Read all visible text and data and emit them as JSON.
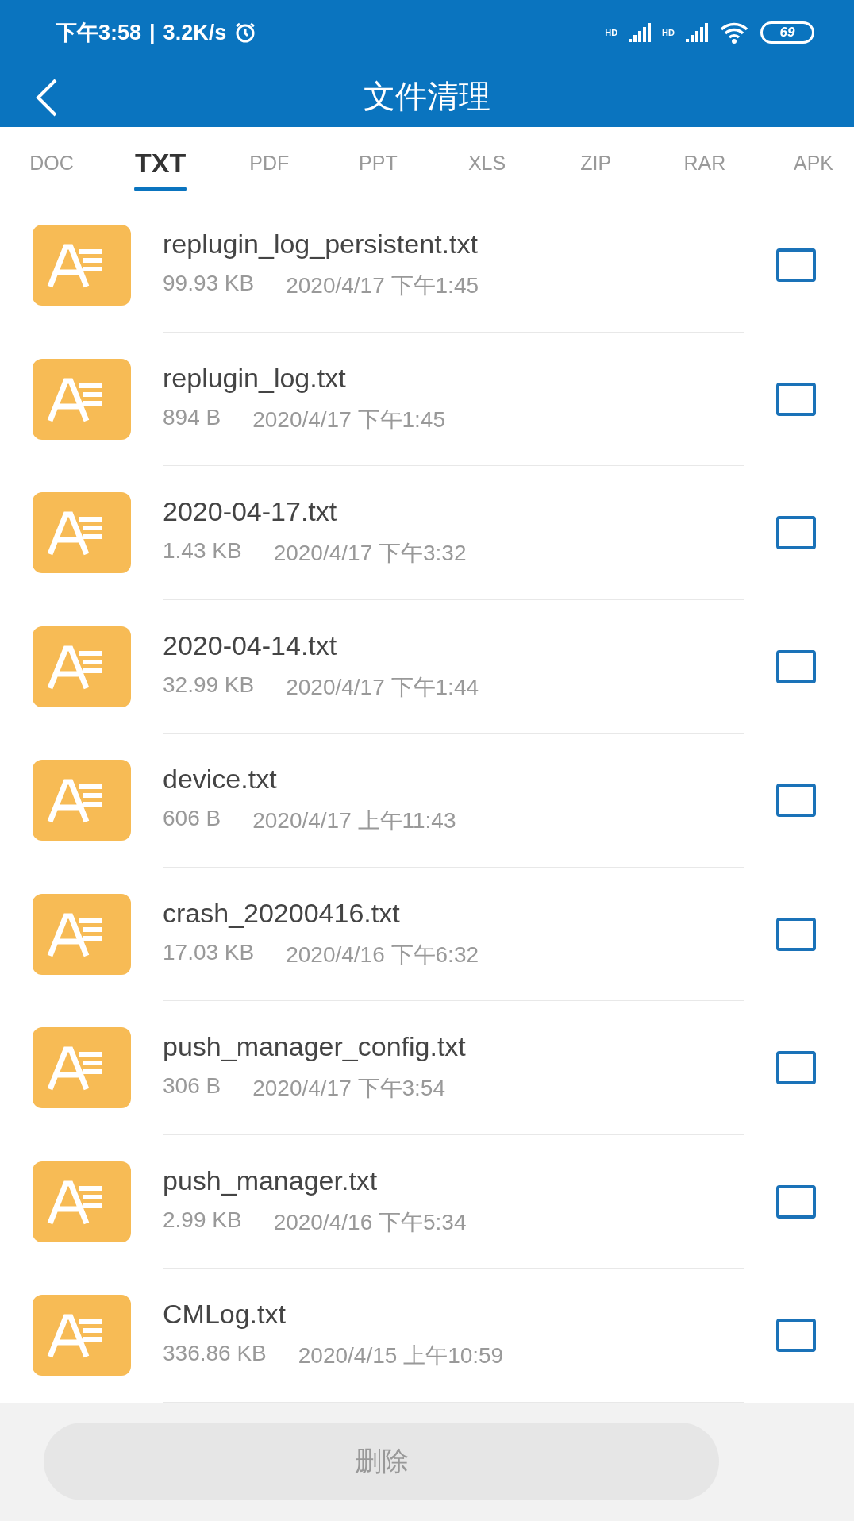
{
  "status_bar": {
    "time": "下午3:58",
    "separator": "|",
    "speed": "3.2K/s",
    "signals": [
      "HD",
      "HD"
    ],
    "battery": "69"
  },
  "header": {
    "title": "文件清理"
  },
  "tabs": [
    {
      "label": "DOC",
      "selected": false
    },
    {
      "label": "TXT",
      "selected": true
    },
    {
      "label": "PDF",
      "selected": false
    },
    {
      "label": "PPT",
      "selected": false
    },
    {
      "label": "XLS",
      "selected": false
    },
    {
      "label": "ZIP",
      "selected": false
    },
    {
      "label": "RAR",
      "selected": false
    },
    {
      "label": "APK",
      "selected": false
    }
  ],
  "files": [
    {
      "name": "replugin_log_persistent.txt",
      "size": "99.93 KB",
      "time": "2020/4/17 下午1:45",
      "checked": false
    },
    {
      "name": "replugin_log.txt",
      "size": "894 B",
      "time": "2020/4/17 下午1:45",
      "checked": false
    },
    {
      "name": "2020-04-17.txt",
      "size": "1.43 KB",
      "time": "2020/4/17 下午3:32",
      "checked": false
    },
    {
      "name": "2020-04-14.txt",
      "size": "32.99 KB",
      "time": "2020/4/17 下午1:44",
      "checked": false
    },
    {
      "name": "device.txt",
      "size": "606 B",
      "time": "2020/4/17 上午11:43",
      "checked": false
    },
    {
      "name": "crash_20200416.txt",
      "size": "17.03 KB",
      "time": "2020/4/16 下午6:32",
      "checked": false
    },
    {
      "name": "push_manager_config.txt",
      "size": "306 B",
      "time": "2020/4/17 下午3:54",
      "checked": false
    },
    {
      "name": "push_manager.txt",
      "size": "2.99 KB",
      "time": "2020/4/16 下午5:34",
      "checked": false
    },
    {
      "name": "CMLog.txt",
      "size": "336.86 KB",
      "time": "2020/4/15 上午10:59",
      "checked": false
    }
  ],
  "delete_button": {
    "label": "删除",
    "disabled": true
  }
}
